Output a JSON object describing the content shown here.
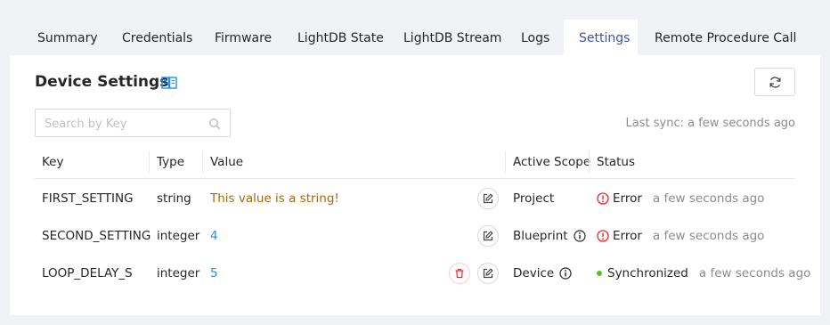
{
  "tabs": [
    {
      "label": "Summary"
    },
    {
      "label": "Credentials"
    },
    {
      "label": "Firmware"
    },
    {
      "label": "LightDB State"
    },
    {
      "label": "LightDB Stream"
    },
    {
      "label": "Logs"
    },
    {
      "label": "Settings",
      "active": true
    },
    {
      "label": "Remote Procedure Call"
    }
  ],
  "page": {
    "title": "Device Settings",
    "search_placeholder": "Search by Key",
    "last_sync": "Last sync: a few seconds ago"
  },
  "table": {
    "headers": {
      "key": "Key",
      "type": "Type",
      "value": "Value",
      "scope": "Active Scope",
      "status": "Status"
    },
    "rows": [
      {
        "key": "FIRST_SETTING",
        "type": "string",
        "value": "This value is a string!",
        "scope": "Project",
        "status": "Error",
        "time": "a few seconds ago"
      },
      {
        "key": "SECOND_SETTING",
        "type": "integer",
        "value": "4",
        "scope": "Blueprint",
        "status": "Error",
        "time": "a few seconds ago"
      },
      {
        "key": "LOOP_DELAY_S",
        "type": "integer",
        "value": "5",
        "scope": "Device",
        "status": "Synchronized",
        "time": "a few seconds ago"
      }
    ]
  },
  "colors": {
    "accent": "#3f51b5",
    "error": "#f5222d",
    "success": "#52c41a",
    "string_value": "#a06a15",
    "number_value": "#1890ff"
  },
  "icons": {
    "docs": "book-icon",
    "refresh": "refresh-icon",
    "search": "search-icon",
    "edit": "edit-icon",
    "delete": "delete-icon",
    "info": "info-icon",
    "error": "error-icon"
  }
}
